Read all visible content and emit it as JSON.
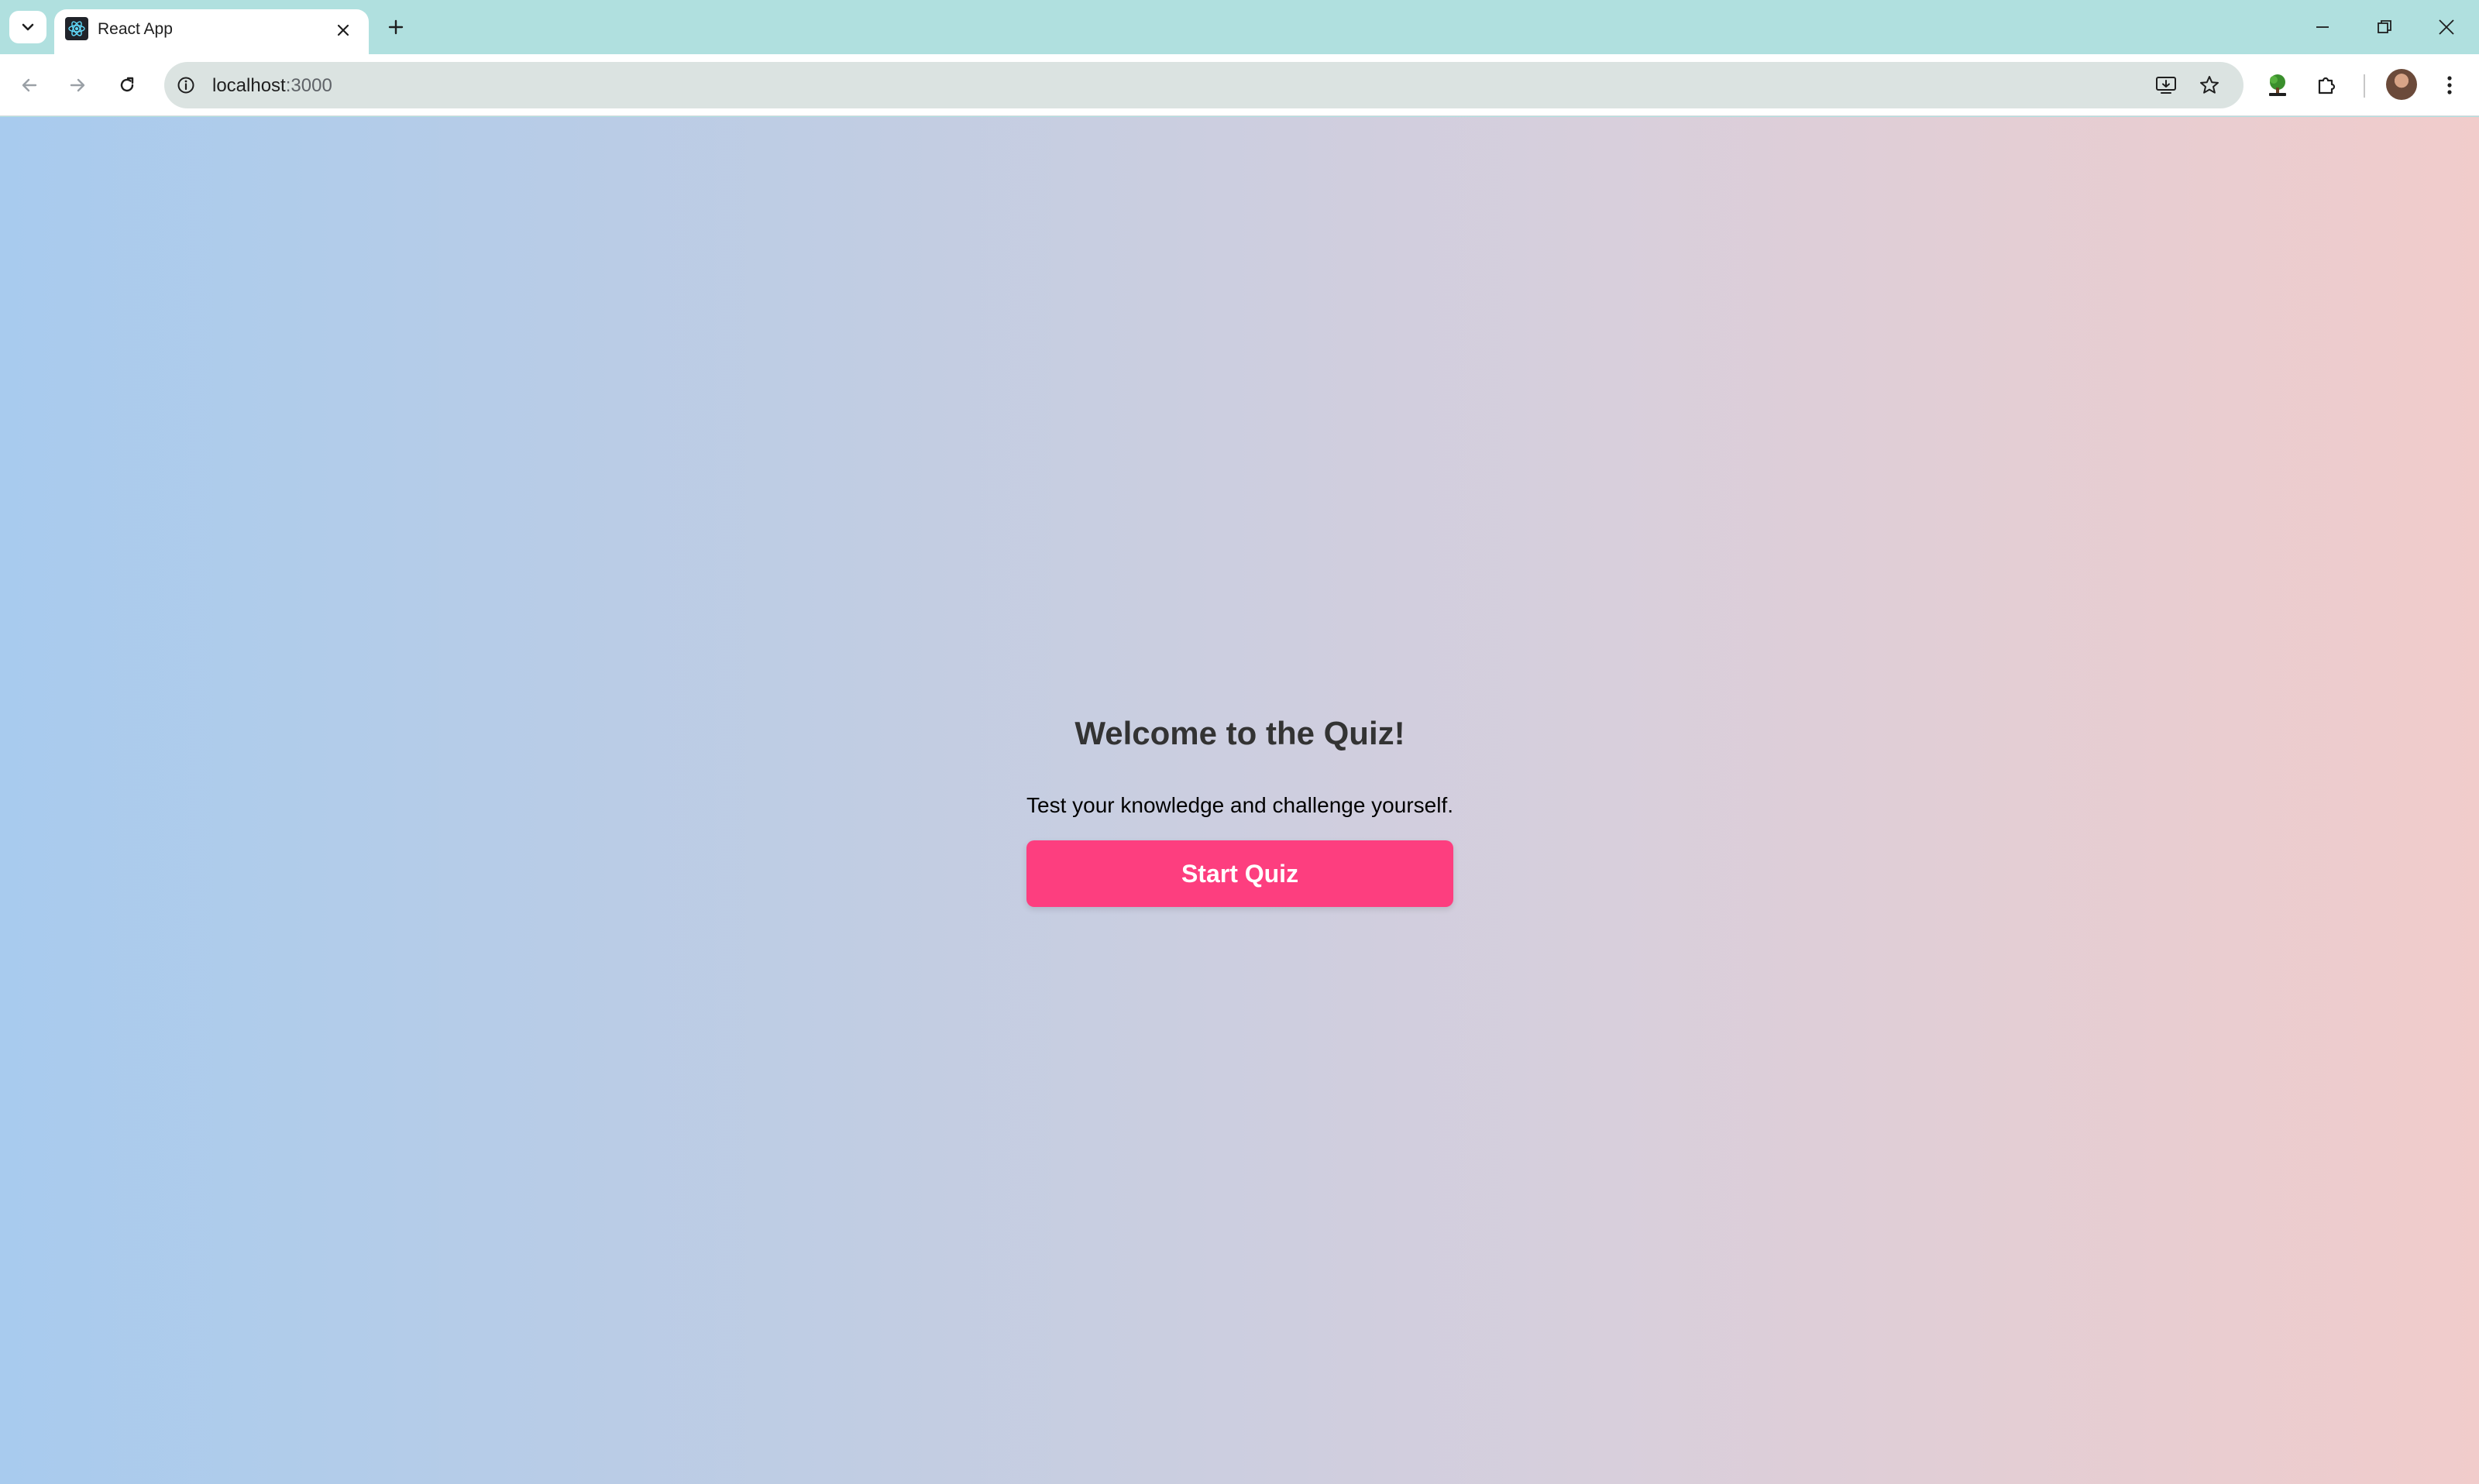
{
  "browser": {
    "tab": {
      "title": "React App"
    },
    "address": {
      "host": "localhost",
      "port": ":3000"
    },
    "icons": {
      "tab_search": "chevron-down-icon",
      "favicon": "react-icon",
      "tab_close": "close-icon",
      "new_tab": "plus-icon",
      "back": "arrow-left-icon",
      "forward": "arrow-right-icon",
      "reload": "reload-icon",
      "site_info": "info-icon",
      "install": "install-app-icon",
      "bookmark": "star-icon",
      "extension": "puzzle-icon",
      "menu": "kebab-menu-icon"
    }
  },
  "page": {
    "heading": "Welcome to the Quiz!",
    "subtitle": "Test your knowledge and challenge yourself.",
    "start_button": "Start Quiz"
  },
  "colors": {
    "accent": "#fd3e7f",
    "heading_text": "#333333",
    "gradient_start": "#a8cbee",
    "gradient_end": "#f1cccb"
  }
}
